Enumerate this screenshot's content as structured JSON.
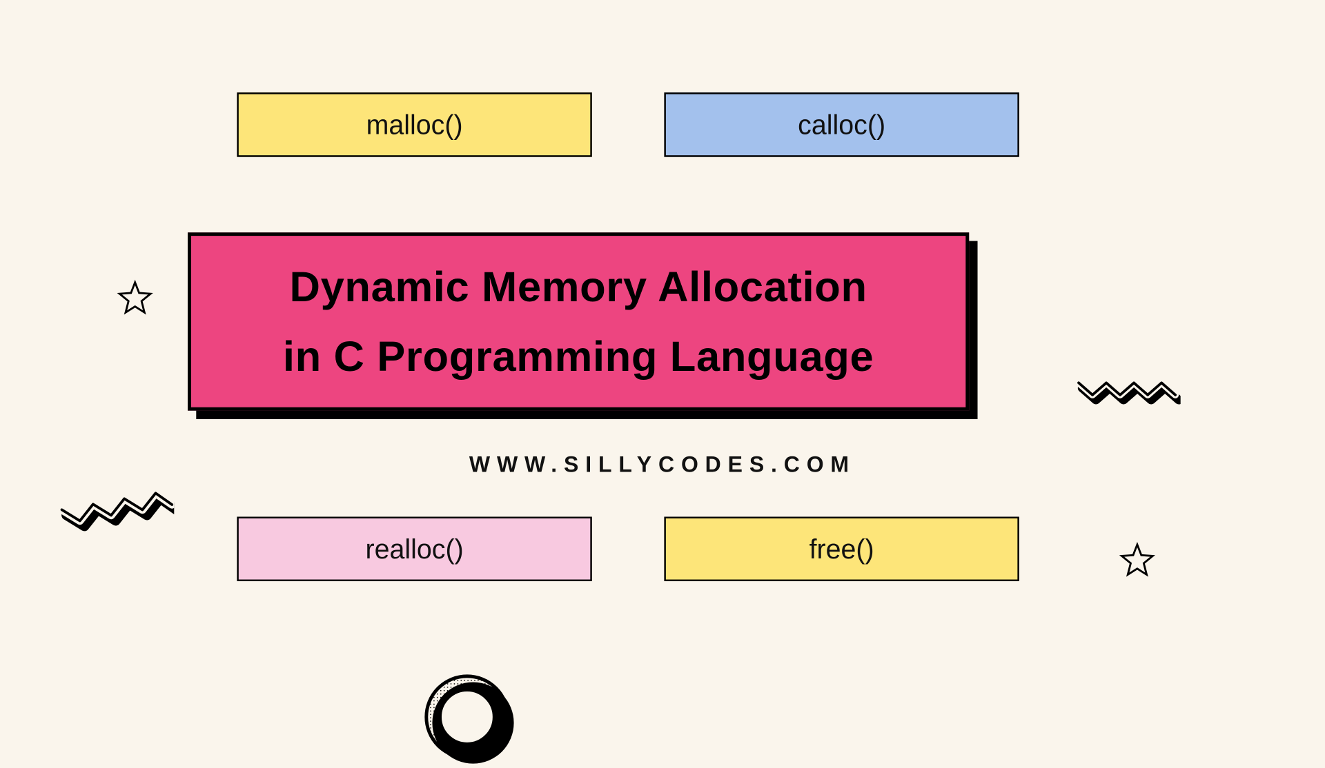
{
  "boxes": {
    "malloc": "malloc()",
    "calloc": "calloc()",
    "realloc": "realloc()",
    "free": "free()"
  },
  "title": {
    "line1": "Dynamic Memory Allocation",
    "line2": "in C Programming Language"
  },
  "url": "WWW.SILLYCODES.COM",
  "colors": {
    "bg": "#faf5ec",
    "yellow": "#fde579",
    "blue": "#a3c1ed",
    "pink": "#f8c9e0",
    "magenta": "#ed4580"
  }
}
